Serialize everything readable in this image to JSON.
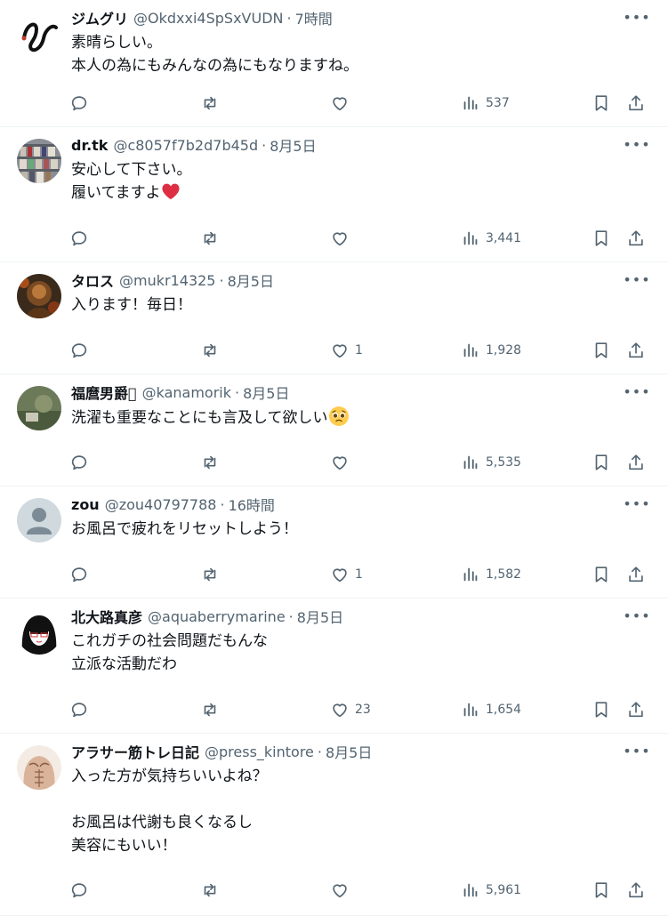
{
  "tweets": [
    {
      "name": "ジムグリ",
      "handle": "@Okdxxi4SpSxVUDN",
      "time": "7時間",
      "lines": [
        "素晴らしい。",
        "本人の為にもみんなの為にもなりますね。"
      ],
      "likes": "",
      "views": "537",
      "avatar": "snake-logo"
    },
    {
      "name": "dr.tk",
      "handle": "@c8057f7b2d7b45d",
      "time": "8月5日",
      "lines": [
        "安心して下さい。",
        "履いてますよ"
      ],
      "likes": "",
      "views": "3,441",
      "avatar": "shelves-photo"
    },
    {
      "name": "タロス",
      "handle": "@mukr14325",
      "time": "8月5日",
      "lines": [
        "入ります！毎日！"
      ],
      "likes": "1",
      "views": "1,928",
      "avatar": "warrior-art"
    },
    {
      "name": "福麿男爵􏿿",
      "handle": "@kanamorik",
      "time": "8月5日",
      "lines": [
        "洗濯も重要なことにも言及して欲しい"
      ],
      "likes": "",
      "views": "5,535",
      "avatar": "photo-green"
    },
    {
      "name": "zou",
      "handle": "@zou40797788",
      "time": "16時間",
      "lines": [
        "お風呂で疲れをリセットしよう！"
      ],
      "likes": "1",
      "views": "1,582",
      "avatar": "default-person"
    },
    {
      "name": "北大路真彦",
      "handle": "@aquaberrymarine",
      "time": "8月5日",
      "lines": [
        "これガチの社会問題だもんな",
        "立派な活動だわ"
      ],
      "likes": "23",
      "views": "1,654",
      "avatar": "anime-girl"
    },
    {
      "name": "アラサー筋トレ日記",
      "handle": "@press_kintore",
      "time": "8月5日",
      "lines": [
        "入った方が気持ちいいよね？",
        "",
        "お風呂は代謝も良くなるし",
        "美容にもいい！"
      ],
      "likes": "",
      "views": "5,961",
      "avatar": "muscle-torso"
    }
  ],
  "ui": {
    "separator": "·",
    "more": "•••"
  },
  "colors": {
    "text": "#0f1419",
    "secondary": "#536471",
    "border": "#eff3f4",
    "heart": "#e0245e"
  }
}
